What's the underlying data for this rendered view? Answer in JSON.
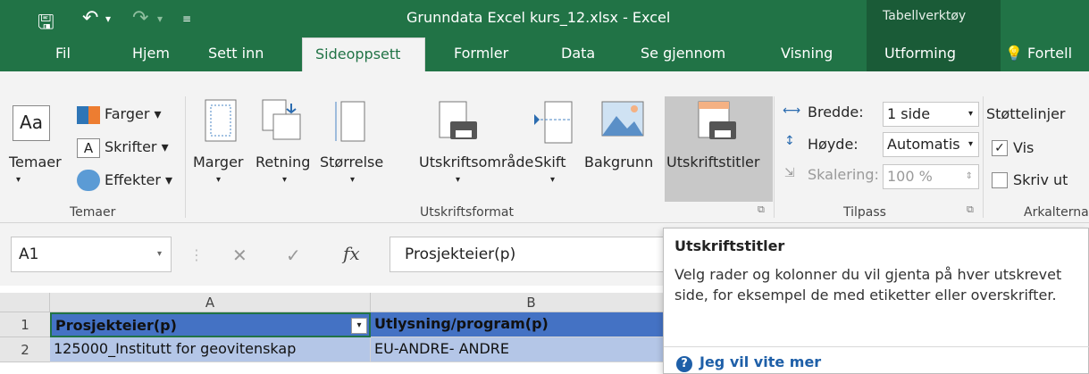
{
  "titlebar": {
    "title": "Grunndata Excel kurs_12.xlsx  -  Excel",
    "context_tab_group": "Tabellverktøy"
  },
  "tabs": [
    "Fil",
    "Hjem",
    "Sett inn",
    "Sideoppsett",
    "Formler",
    "Data",
    "Se gjennom",
    "Visning",
    "Utforming",
    "Fortell r"
  ],
  "active_tab": "Sideoppsett",
  "ribbon": {
    "themes": {
      "themes_label": "Temaer",
      "colors": "Farger ▾",
      "fonts": "Skrifter ▾",
      "effects": "Effekter ▾",
      "group_label": "Temaer"
    },
    "page_setup": {
      "margins": "Marger",
      "orientation": "Retning",
      "size": "Størrelse",
      "print_area": "Utskriftsområde",
      "breaks": "Skift",
      "background": "Bakgrunn",
      "print_titles": "Utskriftstitler",
      "group_label": "Utskriftsformat"
    },
    "scale_to_fit": {
      "width_label": "Bredde:",
      "width_value": "1 side",
      "height_label": "Høyde:",
      "height_value": "Automatis",
      "scale_label": "Skalering:",
      "scale_value": "100 %",
      "group_label": "Tilpass"
    },
    "sheet_options": {
      "gridlines": "Støttelinjer",
      "view": "Vis",
      "view_checked": true,
      "print": "Skriv ut",
      "group_label": "Arkalternat"
    }
  },
  "formula_bar": {
    "name_box": "A1",
    "fx": "fx",
    "value": "Prosjekteier(p)"
  },
  "grid": {
    "columns": [
      "A",
      "B"
    ],
    "rows": [
      {
        "num": "1",
        "cells": [
          "Prosjekteier(p)",
          "Utlysning/program(p)"
        ]
      },
      {
        "num": "2",
        "cells": [
          "125000_Institutt for geovitenskap",
          "EU-ANDRE- ANDRE"
        ]
      }
    ]
  },
  "tooltip": {
    "title": "Utskriftstitler",
    "body": "Velg rader og kolonner du vil gjenta på hver utskrevet side, for eksempel de med etiketter eller overskrifter.",
    "link": "Jeg vil vite mer"
  },
  "colors": {
    "excel_green": "#217346",
    "header_blue": "#4472c4",
    "row_blue": "#b4c6e7"
  }
}
